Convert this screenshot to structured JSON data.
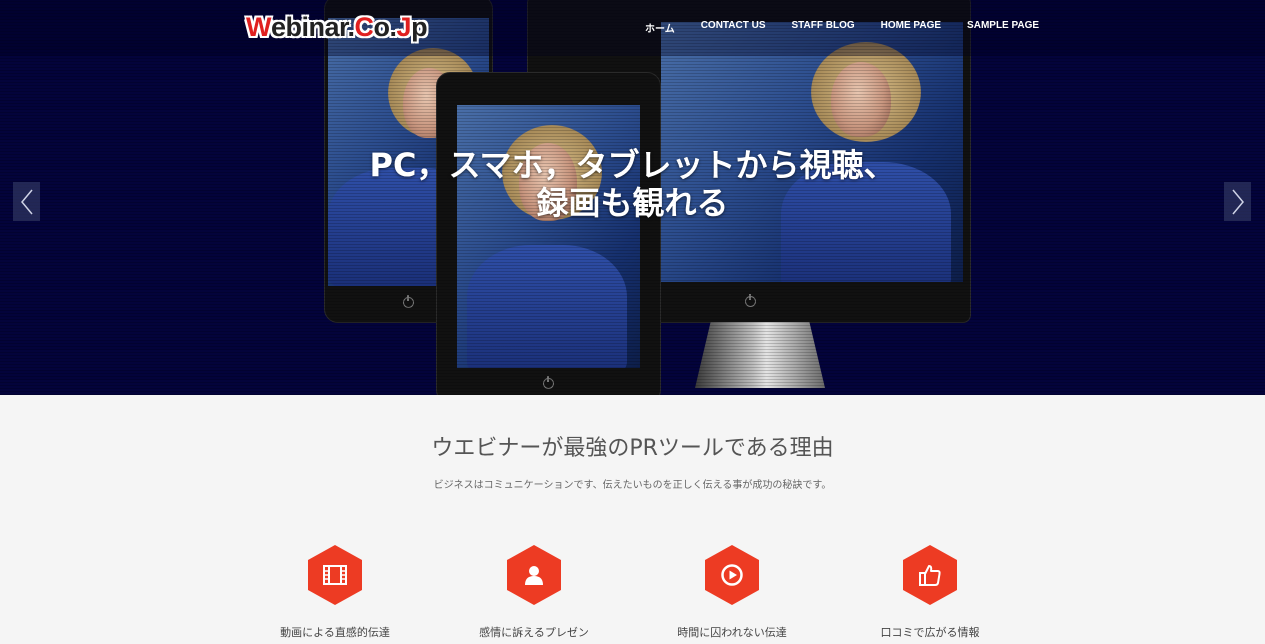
{
  "logo": {
    "first_letter": "W",
    "rest": "ebinar.",
    "co_c": "C",
    "co_rest": "o.",
    "jp_j": "J",
    "jp_rest": "p"
  },
  "nav": [
    {
      "label": "ホーム"
    },
    {
      "label": "CONTACT US"
    },
    {
      "label": "STAFF BLOG"
    },
    {
      "label": "HOME PAGE"
    },
    {
      "label": "SAMPLE PAGE"
    }
  ],
  "hero": {
    "headline_line1": "PC，スマホ，タブレットから視聴、",
    "headline_line2": "録画も観れる",
    "prev_icon": "chevron-left-icon",
    "next_icon": "chevron-right-icon"
  },
  "section": {
    "title": "ウエビナーが最強のPRツールである理由",
    "subtitle": "ビジネスはコミュニケーションです、伝えたいものを正しく伝える事が成功の秘訣です。"
  },
  "features": [
    {
      "icon": "film-icon",
      "label": "動画による直感的伝達"
    },
    {
      "icon": "user-icon",
      "label": "感情に訴えるプレゼン"
    },
    {
      "icon": "play-icon",
      "label": "時間に囚われない伝達"
    },
    {
      "icon": "thumbs-up-icon",
      "label": "口コミで広がる情報"
    }
  ],
  "colors": {
    "hero_bg": "#03033b",
    "accent": "#ed3b23",
    "page_bg": "#f5f5f5"
  }
}
